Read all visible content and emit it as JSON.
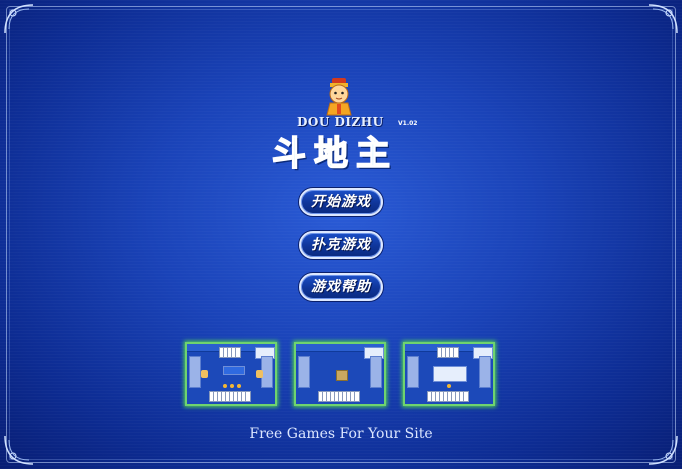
{
  "logo": {
    "title_en": "DOU DIZHU",
    "version": "V1.02",
    "title_cn": "斗地主"
  },
  "menu": {
    "start_label": "开始游戏",
    "poker_label": "扑克游戏",
    "help_label": "游戏帮助"
  },
  "screenshots": [
    {
      "name": "screenshot-1"
    },
    {
      "name": "screenshot-2"
    },
    {
      "name": "screenshot-3"
    }
  ],
  "tagline": "Free Games For Your Site",
  "colors": {
    "background": "#1a43b8",
    "button_border": "#dde8ff",
    "thumbnail_glow": "#53d653",
    "logo_cyan": "#3fc8ff"
  }
}
